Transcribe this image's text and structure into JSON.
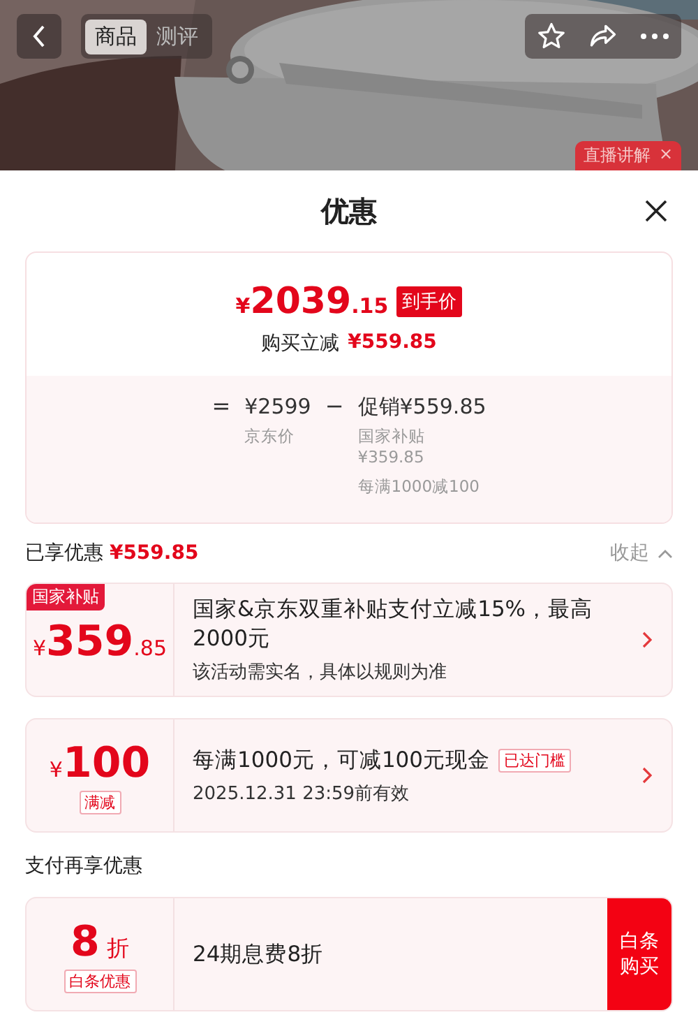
{
  "top_bar": {
    "tabs": [
      {
        "label": "商品",
        "selected": true
      },
      {
        "label": "测评",
        "selected": false
      }
    ],
    "live_badge": {
      "label": "直播讲解",
      "close": "×"
    }
  },
  "sheet": {
    "title": "优惠"
  },
  "price_card": {
    "currency": "¥",
    "price_integer": "2039",
    "price_decimal": ".15",
    "price_tag": "到手价",
    "instant_label": "购买立减",
    "instant_amount": "¥559.85",
    "formula": {
      "equals": "=",
      "base_price": "¥2599",
      "base_label": "京东价",
      "minus": "−",
      "promo": "促销¥559.85",
      "promo_details": [
        {
          "lines": [
            "国家补贴",
            "¥359.85"
          ]
        },
        {
          "lines": [
            "每满1000减100"
          ]
        }
      ]
    }
  },
  "enjoyed": {
    "label": "已享优惠",
    "amount": "¥559.85",
    "toggle": "收起",
    "expanded": true
  },
  "coupons": [
    {
      "kind": "amount",
      "tag": "国家补贴",
      "currency": "¥",
      "amount_integer": "359",
      "amount_decimal": ".85",
      "title": "国家&京东双重补贴支付立减15%，最高2000元",
      "note": "该活动需实名，具体以规则为准"
    },
    {
      "kind": "amount",
      "sub_tag": "满减",
      "currency": "¥",
      "amount_integer": "100",
      "title": "每满1000元，可减100元现金",
      "status": "已达门槛",
      "note": "2025.12.31 23:59前有效"
    }
  ],
  "payment": {
    "title": "支付再享优惠",
    "offers": [
      {
        "kind": "discount",
        "amount_integer": "8",
        "unit": "折",
        "sub_tag": "白条优惠",
        "title": "24期息费8折",
        "action": "白条购买"
      }
    ]
  }
}
